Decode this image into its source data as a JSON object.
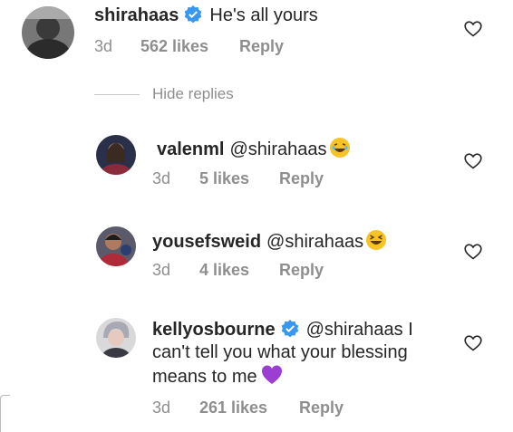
{
  "comment": {
    "username": "shirahaas",
    "text": "He's all yours",
    "age": "3d",
    "likes": "562 likes",
    "reply": "Reply"
  },
  "hide_replies": "Hide replies",
  "replies": [
    {
      "username": "valenml",
      "mention": "@shirahaas",
      "age": "3d",
      "likes": "5 likes",
      "reply": "Reply"
    },
    {
      "username": "yousefsweid",
      "mention": "@shirahaas",
      "age": "3d",
      "likes": "4 likes",
      "reply": "Reply"
    },
    {
      "username": "kellyosbourne",
      "mention": "@shirahaas",
      "text_1": "I",
      "text_2": "can't tell you what your blessing",
      "text_3": "means to me",
      "age": "3d",
      "likes": "261 likes",
      "reply": "Reply"
    }
  ],
  "colors": {
    "verified_blue": "#3897f0",
    "muted_gray": "#8e8e8e",
    "heart_emoji": "#9b3fd3",
    "laugh_emoji": "#f7c325"
  },
  "icons": {
    "like": "heart-outline-icon",
    "verified": "verified-badge-icon",
    "laugh": "laughing-emoji-icon",
    "purple_heart": "purple-heart-emoji-icon"
  }
}
